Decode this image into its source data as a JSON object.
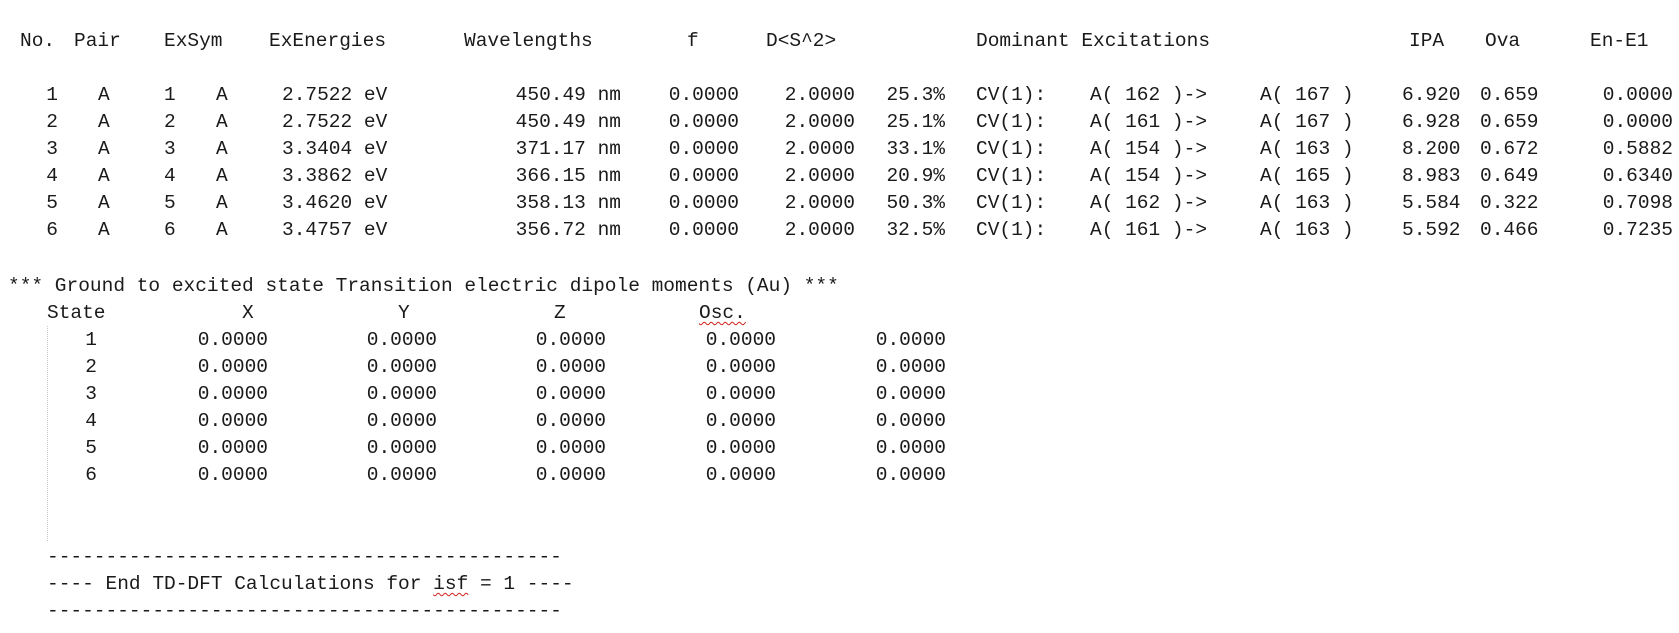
{
  "header": {
    "no": "No.",
    "pair": "Pair",
    "exsym": "ExSym",
    "exenergies": "ExEnergies",
    "wavelengths": "Wavelengths",
    "f": "f",
    "ds2": "D<S^2>",
    "dominant": "Dominant Excitations",
    "ipa": "IPA",
    "ova": "Ova",
    "ene1": "En-E1"
  },
  "rows": [
    {
      "no": "1",
      "pair": "A",
      "exsym_n": "1",
      "exsym_s": "A",
      "energy": "2.7522 eV",
      "wave": "450.49 nm",
      "f": "0.0000",
      "ds2": "2.0000",
      "pct": "25.3%",
      "cv": "CV(1):",
      "from": "A( 162 )->",
      "to": "A( 167 )",
      "ipa": "6.920",
      "ova": "0.659",
      "ene1": "0.0000"
    },
    {
      "no": "2",
      "pair": "A",
      "exsym_n": "2",
      "exsym_s": "A",
      "energy": "2.7522 eV",
      "wave": "450.49 nm",
      "f": "0.0000",
      "ds2": "2.0000",
      "pct": "25.1%",
      "cv": "CV(1):",
      "from": "A( 161 )->",
      "to": "A( 167 )",
      "ipa": "6.928",
      "ova": "0.659",
      "ene1": "0.0000"
    },
    {
      "no": "3",
      "pair": "A",
      "exsym_n": "3",
      "exsym_s": "A",
      "energy": "3.3404 eV",
      "wave": "371.17 nm",
      "f": "0.0000",
      "ds2": "2.0000",
      "pct": "33.1%",
      "cv": "CV(1):",
      "from": "A( 154 )->",
      "to": "A( 163 )",
      "ipa": "8.200",
      "ova": "0.672",
      "ene1": "0.5882"
    },
    {
      "no": "4",
      "pair": "A",
      "exsym_n": "4",
      "exsym_s": "A",
      "energy": "3.3862 eV",
      "wave": "366.15 nm",
      "f": "0.0000",
      "ds2": "2.0000",
      "pct": "20.9%",
      "cv": "CV(1):",
      "from": "A( 154 )->",
      "to": "A( 165 )",
      "ipa": "8.983",
      "ova": "0.649",
      "ene1": "0.6340"
    },
    {
      "no": "5",
      "pair": "A",
      "exsym_n": "5",
      "exsym_s": "A",
      "energy": "3.4620 eV",
      "wave": "358.13 nm",
      "f": "0.0000",
      "ds2": "2.0000",
      "pct": "50.3%",
      "cv": "CV(1):",
      "from": "A( 162 )->",
      "to": "A( 163 )",
      "ipa": "5.584",
      "ova": "0.322",
      "ene1": "0.7098"
    },
    {
      "no": "6",
      "pair": "A",
      "exsym_n": "6",
      "exsym_s": "A",
      "energy": "3.4757 eV",
      "wave": "356.72 nm",
      "f": "0.0000",
      "ds2": "2.0000",
      "pct": "32.5%",
      "cv": "CV(1):",
      "from": "A( 161 )->",
      "to": "A( 163 )",
      "ipa": "5.592",
      "ova": "0.466",
      "ene1": "0.7235"
    }
  ],
  "dipole": {
    "title": "*** Ground to excited state Transition electric dipole moments (Au) ***",
    "headers": [
      "State",
      "X",
      "Y",
      "Z",
      "Osc."
    ],
    "rows": [
      [
        "1",
        "0.0000",
        "0.0000",
        "0.0000",
        "0.0000",
        "0.0000"
      ],
      [
        "2",
        "0.0000",
        "0.0000",
        "0.0000",
        "0.0000",
        "0.0000"
      ],
      [
        "3",
        "0.0000",
        "0.0000",
        "0.0000",
        "0.0000",
        "0.0000"
      ],
      [
        "4",
        "0.0000",
        "0.0000",
        "0.0000",
        "0.0000",
        "0.0000"
      ],
      [
        "5",
        "0.0000",
        "0.0000",
        "0.0000",
        "0.0000",
        "0.0000"
      ],
      [
        "6",
        "0.0000",
        "0.0000",
        "0.0000",
        "0.0000",
        "0.0000"
      ]
    ]
  },
  "footer": {
    "dashes": "--------------------------------------------",
    "end_prefix": "---- End TD-DFT Calculations for ",
    "end_isf": "isf",
    "end_suffix": " = 1 ----"
  }
}
